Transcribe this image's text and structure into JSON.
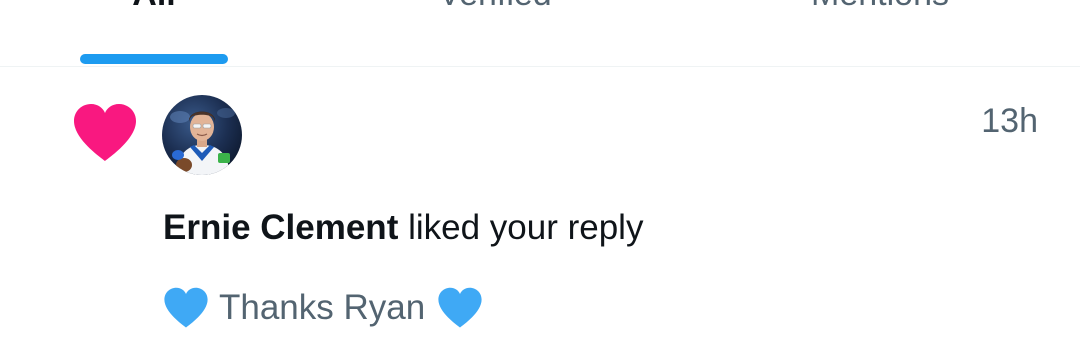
{
  "tabs": [
    {
      "label": "All",
      "active": true
    },
    {
      "label": "Verified",
      "active": false
    },
    {
      "label": "Mentions",
      "active": false
    }
  ],
  "colors": {
    "accent": "#1d9bf0",
    "like_heart": "#f91880",
    "secondary_text": "#536471",
    "primary_text": "#0f1419",
    "blue_heart_emoji": "#3fa9f5"
  },
  "notification": {
    "type_icon": "heart-icon",
    "timestamp": "13h",
    "actor_name": "Ernie Clement",
    "action_text": " liked your reply",
    "reply_text": "Thanks Ryan",
    "reply_emoji": "blue-heart-emoji"
  }
}
